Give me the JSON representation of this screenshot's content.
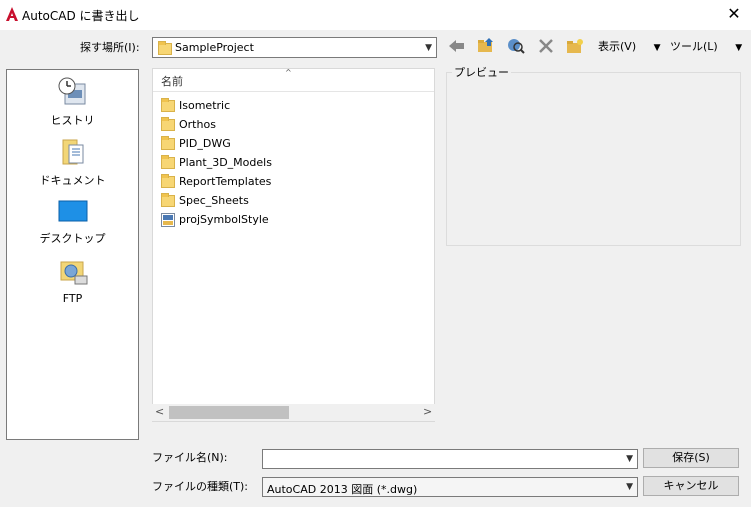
{
  "window": {
    "title": "AutoCAD に書き出し",
    "close_glyph": "✕"
  },
  "lookin": {
    "label": "探す場所(I):",
    "value": "SampleProject",
    "toolbar": {
      "back_icon": "back-arrow-icon",
      "up_icon": "up-folder-icon",
      "search_icon": "search-web-icon",
      "delete_icon": "delete-icon",
      "newfolder_icon": "new-folder-icon",
      "view_label": "表示(V)",
      "tools_label": "ツール(L)"
    }
  },
  "places": [
    {
      "label": "ヒストリ",
      "icon": "history-icon"
    },
    {
      "label": "ドキュメント",
      "icon": "documents-icon"
    },
    {
      "label": "デスクトップ",
      "icon": "desktop-icon"
    },
    {
      "label": "FTP",
      "icon": "ftp-icon"
    }
  ],
  "filelist": {
    "column_header": "名前",
    "items": [
      {
        "name": "Isometric",
        "type": "folder"
      },
      {
        "name": "Orthos",
        "type": "folder"
      },
      {
        "name": "PID_DWG",
        "type": "folder"
      },
      {
        "name": "Plant_3D_Models",
        "type": "folder"
      },
      {
        "name": "ReportTemplates",
        "type": "folder"
      },
      {
        "name": "Spec_Sheets",
        "type": "folder"
      },
      {
        "name": "projSymbolStyle",
        "type": "dwg-file"
      }
    ]
  },
  "preview": {
    "label": "プレビュー"
  },
  "filename": {
    "label": "ファイル名(N):",
    "value": ""
  },
  "filetype": {
    "label": "ファイルの種類(T):",
    "value": "AutoCAD 2013 図面 (*.dwg)"
  },
  "buttons": {
    "save": "保存(S)",
    "cancel": "キャンセル"
  },
  "colors": {
    "autocad_red": "#c8102e",
    "folder": "#f7d674",
    "desktop_blue": "#1e90e6"
  }
}
